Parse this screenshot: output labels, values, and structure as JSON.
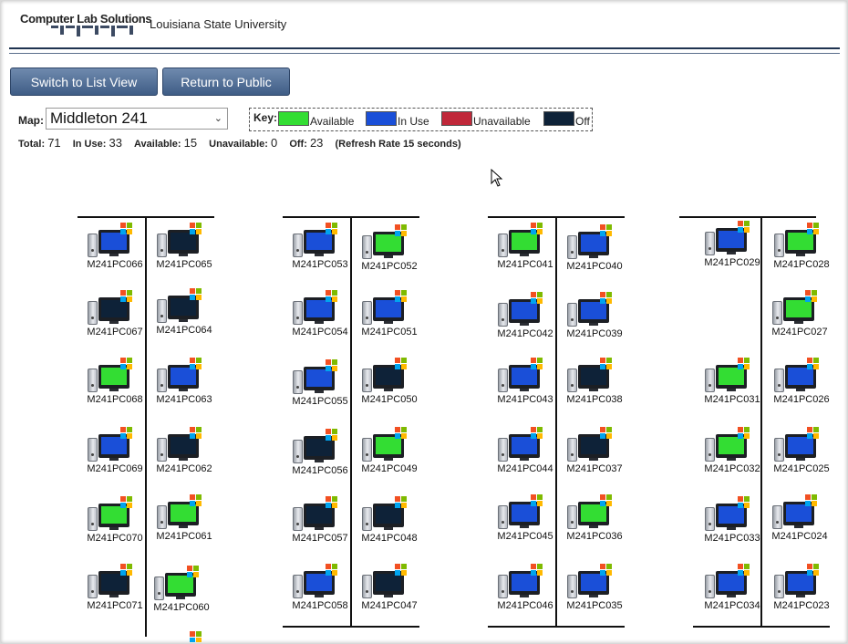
{
  "header": {
    "logo_text": "Computer Lab Solutions",
    "university": "Louisiana State University"
  },
  "toolbar": {
    "list_view_label": "Switch to List View",
    "public_label": "Return to Public"
  },
  "map": {
    "label": "Map:",
    "selected": "Middleton 241"
  },
  "key": {
    "label": "Key:",
    "items": [
      {
        "label": "Available",
        "color": "#33dd33"
      },
      {
        "label": "In Use",
        "color": "#1a4fd8"
      },
      {
        "label": "Unavailable",
        "color": "#c0283a"
      },
      {
        "label": "Off",
        "color": "#0e2238"
      }
    ]
  },
  "stats": {
    "total_label": "Total:",
    "total": "71",
    "inuse_label": "In Use:",
    "inuse": "33",
    "available_label": "Available:",
    "available": "15",
    "unavailable_label": "Unavailable:",
    "unavailable": "0",
    "off_label": "Off:",
    "off": "23",
    "refresh": "(Refresh Rate 15 seconds)"
  },
  "colors": {
    "available": "#33dd33",
    "inuse": "#1a4fd8",
    "off": "#0e2238"
  },
  "computers": [
    {
      "name": "M241PC066",
      "status": "inuse"
    },
    {
      "name": "M241PC065",
      "status": "off"
    },
    {
      "name": "M241PC067",
      "status": "off"
    },
    {
      "name": "M241PC064",
      "status": "off"
    },
    {
      "name": "M241PC068",
      "status": "available"
    },
    {
      "name": "M241PC063",
      "status": "inuse"
    },
    {
      "name": "M241PC069",
      "status": "inuse"
    },
    {
      "name": "M241PC062",
      "status": "off"
    },
    {
      "name": "M241PC070",
      "status": "available"
    },
    {
      "name": "M241PC061",
      "status": "available"
    },
    {
      "name": "M241PC071",
      "status": "off"
    },
    {
      "name": "M241PC060",
      "status": "available"
    },
    {
      "name": "M241PC053",
      "status": "inuse"
    },
    {
      "name": "M241PC052",
      "status": "available"
    },
    {
      "name": "M241PC054",
      "status": "inuse"
    },
    {
      "name": "M241PC051",
      "status": "inuse"
    },
    {
      "name": "M241PC055",
      "status": "inuse"
    },
    {
      "name": "M241PC050",
      "status": "off"
    },
    {
      "name": "M241PC056",
      "status": "off"
    },
    {
      "name": "M241PC049",
      "status": "available"
    },
    {
      "name": "M241PC057",
      "status": "off"
    },
    {
      "name": "M241PC048",
      "status": "off"
    },
    {
      "name": "M241PC058",
      "status": "inuse"
    },
    {
      "name": "M241PC047",
      "status": "off"
    },
    {
      "name": "M241PC041",
      "status": "available"
    },
    {
      "name": "M241PC040",
      "status": "inuse"
    },
    {
      "name": "M241PC042",
      "status": "inuse"
    },
    {
      "name": "M241PC039",
      "status": "inuse"
    },
    {
      "name": "M241PC043",
      "status": "inuse"
    },
    {
      "name": "M241PC038",
      "status": "off"
    },
    {
      "name": "M241PC044",
      "status": "inuse"
    },
    {
      "name": "M241PC037",
      "status": "off"
    },
    {
      "name": "M241PC045",
      "status": "inuse"
    },
    {
      "name": "M241PC036",
      "status": "available"
    },
    {
      "name": "M241PC046",
      "status": "inuse"
    },
    {
      "name": "M241PC035",
      "status": "inuse"
    },
    {
      "name": "M241PC029",
      "status": "inuse"
    },
    {
      "name": "M241PC028",
      "status": "available"
    },
    {
      "name": "M241PC027",
      "status": "available"
    },
    {
      "name": "M241PC031",
      "status": "available"
    },
    {
      "name": "M241PC026",
      "status": "inuse"
    },
    {
      "name": "M241PC032",
      "status": "available"
    },
    {
      "name": "M241PC025",
      "status": "inuse"
    },
    {
      "name": "M241PC033",
      "status": "inuse"
    },
    {
      "name": "M241PC024",
      "status": "inuse"
    },
    {
      "name": "M241PC034",
      "status": "inuse"
    },
    {
      "name": "M241PC023",
      "status": "inuse"
    }
  ]
}
